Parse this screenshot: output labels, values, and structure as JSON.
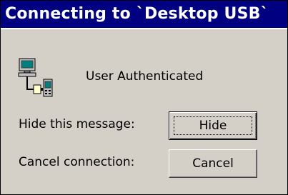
{
  "dialog": {
    "title": "Connecting to `Desktop USB`",
    "status_text": "User Authenticated",
    "status_icon": "connection-authenticated-icon",
    "hide_label": "Hide this message:",
    "hide_button": "Hide",
    "cancel_label": "Cancel connection:",
    "cancel_button": "Cancel"
  },
  "colors": {
    "titlebar": "#000080",
    "title_text": "#ffffff",
    "dialog_bg": "#d4d0c8"
  }
}
